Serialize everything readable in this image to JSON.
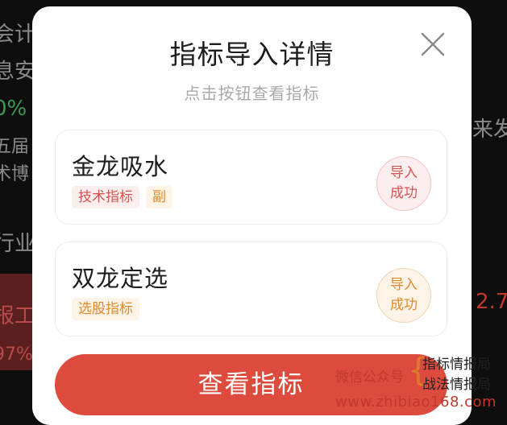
{
  "background": {
    "fragments": [
      {
        "text": "会计"
      },
      {
        "text": "息安"
      },
      {
        "text": "0%"
      },
      {
        "text": "五届"
      },
      {
        "text": "术博"
      },
      {
        "text": "行业"
      },
      {
        "text": "报工"
      },
      {
        "text": "97%"
      },
      {
        "text": "来发"
      },
      {
        "text": "2.7"
      }
    ]
  },
  "modal": {
    "title": "指标导入详情",
    "subtitle": "点击按钮查看指标",
    "close_icon": "close-icon",
    "items": [
      {
        "name": "金龙吸水",
        "tags": [
          "技术指标",
          "副"
        ],
        "status_line1": "导入",
        "status_line2": "成功",
        "color": "#d9534f"
      },
      {
        "name": "双龙定选",
        "tags": [
          "选股指标"
        ],
        "status_line1": "导入",
        "status_line2": "成功",
        "color": "#e08a2e"
      }
    ],
    "view_button_label": "查看指标",
    "accent_color": "#dd4b3e"
  },
  "watermark": {
    "label": "微信公众号",
    "line1": "指标情报局",
    "line2": "战法情报局",
    "url": "www.zhibiao168.com"
  }
}
